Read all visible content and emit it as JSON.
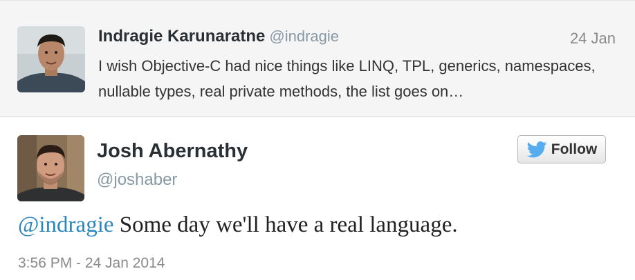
{
  "parent_tweet": {
    "author_name": "Indragie Karunaratne",
    "author_handle": "@indragie",
    "date": "24 Jan",
    "text": "I wish Objective-C had nice things like LINQ, TPL, generics, namespaces, nullable types, real private methods, the list goes on…",
    "avatar": "profile-photo"
  },
  "main_tweet": {
    "author_name": "Josh Abernathy",
    "author_handle": "@joshaber",
    "follow_label": "Follow",
    "follow_icon": "twitter-bird-icon",
    "mention": "@indragie",
    "text": "Some day we'll have a real language.",
    "timestamp": "3:56 PM - 24 Jan 2014",
    "avatar": "profile-photo"
  },
  "colors": {
    "link": "#2a87bd",
    "twitter_blue": "#55acee",
    "muted_text": "#8899a6"
  }
}
